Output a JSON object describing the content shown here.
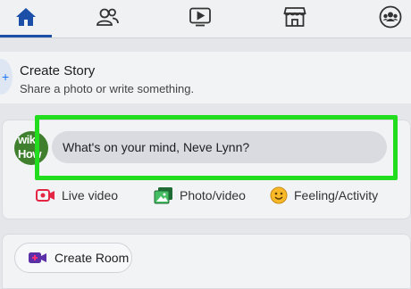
{
  "nav": {
    "tabs": [
      {
        "icon": "home-icon",
        "active": true
      },
      {
        "icon": "friends-icon",
        "active": false
      },
      {
        "icon": "watch-icon",
        "active": false
      },
      {
        "icon": "marketplace-icon",
        "active": false
      },
      {
        "icon": "groups-icon",
        "active": false
      }
    ],
    "accent": "#1b4fa8"
  },
  "story": {
    "title": "Create Story",
    "subtitle": "Share a photo or write something."
  },
  "composer": {
    "avatar_text_line1": "wiki",
    "avatar_text_line2": "How",
    "placeholder": "What's on your mind, Neve Lynn?",
    "highlight_color": "#22dd1e",
    "actions": [
      {
        "label": "Live video",
        "icon": "live-video-icon",
        "color": "#e42645"
      },
      {
        "label": "Photo/video",
        "icon": "photo-video-icon",
        "color": "#45bd62"
      },
      {
        "label": "Feeling/Activity",
        "icon": "feeling-activity-icon",
        "color": "#f7b928"
      }
    ]
  },
  "room": {
    "button_label": "Create Room",
    "icon": "video-room-icon"
  }
}
